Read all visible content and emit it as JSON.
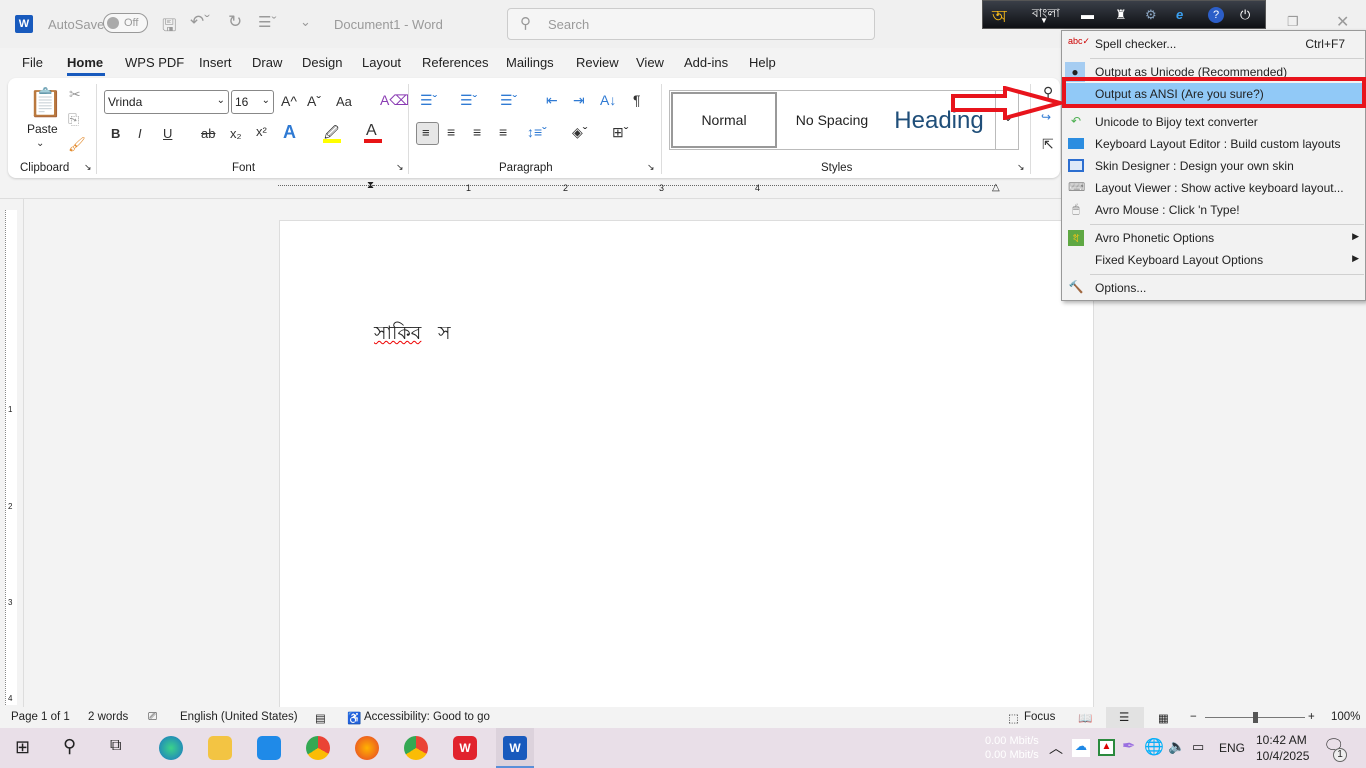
{
  "titlebar": {
    "autosave": "AutoSave",
    "autosave_state": "Off",
    "doc_title": "Document1  -  Word",
    "search_placeholder": "Search"
  },
  "tabs": [
    "File",
    "Home",
    "WPS PDF",
    "Insert",
    "Draw",
    "Design",
    "Layout",
    "References",
    "Mailings",
    "Review",
    "View",
    "Add-ins",
    "Help"
  ],
  "active_tab": "Home",
  "ribbon": {
    "clipboard": {
      "label": "Clipboard",
      "paste": "Paste"
    },
    "font": {
      "label": "Font",
      "font_name": "Vrinda",
      "font_size": "16",
      "bold": "B",
      "italic": "I",
      "underline": "U",
      "strike": "ab",
      "sub": "x₂",
      "sup": "x²",
      "case": "Aa",
      "grow": "A^",
      "shrink": "Aˇ"
    },
    "paragraph": {
      "label": "Paragraph"
    },
    "styles": {
      "label": "Styles",
      "items": [
        "Normal",
        "No Spacing",
        "Heading"
      ]
    }
  },
  "ruler_numbers": [
    "1",
    "2",
    "3",
    "4"
  ],
  "vruler_numbers": [
    "1",
    "2",
    "3",
    "4"
  ],
  "document": {
    "text_word1": "সাকিব",
    "text_word2": "স"
  },
  "status": {
    "page": "Page 1 of 1",
    "words": "2 words",
    "language": "English (United States)",
    "accessibility": "Accessibility: Good to go",
    "focus": "Focus",
    "zoom_minus": "−",
    "zoom_plus": "+",
    "zoom": "100%",
    "zoom_value_percent": 100
  },
  "taskbar": {
    "net_up": "0.00 Mbit/s",
    "net_down": "0.00 Mbit/s",
    "lang": "ENG",
    "time": "10:42 AM",
    "date": "10/4/2025",
    "notif_count": "1"
  },
  "avro": {
    "logo": "অ",
    "mode": "বাংলা"
  },
  "menu": {
    "items": [
      {
        "label": "Spell checker...",
        "shortcut": "Ctrl+F7",
        "icon": "spell-check-icon"
      },
      {
        "label": "Output as Unicode (Recommended)",
        "icon": "radio-bullet-icon"
      },
      {
        "label": "Output as ANSI (Are you sure?)",
        "icon": "none"
      },
      {
        "label": "Unicode to Bijoy text converter",
        "icon": "undo-arrow-icon"
      },
      {
        "label": "Keyboard Layout Editor : Build custom layouts",
        "icon": "keyboard-editor-icon"
      },
      {
        "label": "Skin Designer : Design your own skin",
        "icon": "skin-designer-icon"
      },
      {
        "label": "Layout Viewer : Show active keyboard layout...",
        "icon": "keyboard-icon"
      },
      {
        "label": "Avro Mouse : Click 'n Type!",
        "icon": "mouse-icon"
      },
      {
        "label": "Avro Phonetic Options",
        "icon": "phonetic-icon"
      },
      {
        "label": "Fixed Keyboard Layout Options",
        "icon": "none"
      },
      {
        "label": "Options...",
        "icon": "tools-icon"
      }
    ]
  },
  "colors": {
    "word_blue": "#185abd",
    "highlight": "#91c9f7",
    "annotation_red": "#e8141c",
    "avro_bar": "#1a1d22"
  }
}
